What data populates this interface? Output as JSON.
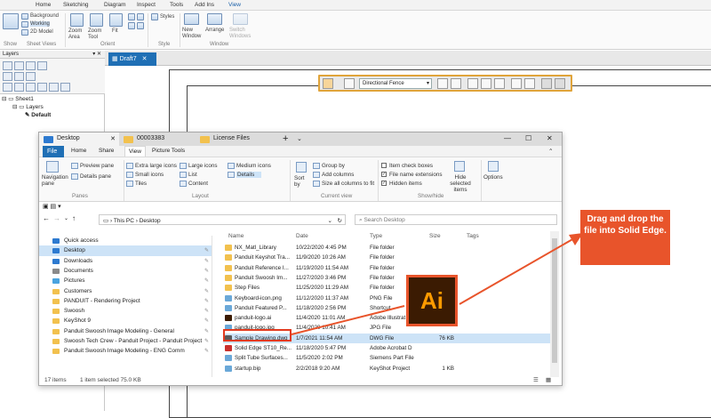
{
  "solid_edge": {
    "tabs": [
      "Home",
      "Sketching",
      "Diagram",
      "Inspect",
      "Tools",
      "Add Ins",
      "View"
    ],
    "active_tab": "View",
    "ribbon": {
      "sheet_views_items": [
        "Background",
        "Working",
        "2D Model"
      ],
      "zoom_area": "Zoom Area",
      "zoom_tool": "Zoom Tool",
      "fit": "Fit",
      "styles": "Styles",
      "new_window": "New Window",
      "arrange": "Arrange",
      "switch_windows": "Switch Windows",
      "groups": [
        "Show",
        "Sheet Views",
        "Orient",
        "Style",
        "Window"
      ]
    },
    "layers_pane": {
      "title": "Layers",
      "tree": [
        "Sheet1",
        "Layers",
        "Default"
      ]
    },
    "document_tab": "Draft7",
    "command_bar": {
      "fence_value": "Directional Fence"
    }
  },
  "explorer": {
    "tabs": [
      "Desktop",
      "00003383",
      "License Files"
    ],
    "menu": [
      "File",
      "Home",
      "Share",
      "View",
      "Picture Tools"
    ],
    "ribbon": {
      "navigation_pane": "Navigation pane",
      "preview_pane": "Preview pane",
      "details_pane": "Details pane",
      "panes_label": "Panes",
      "layout_items": [
        "Extra large icons",
        "Large icons",
        "Medium icons",
        "Small icons",
        "List",
        "Details",
        "Tiles",
        "Content"
      ],
      "layout_label": "Layout",
      "sort_by": "Sort by",
      "group_by": "Group by",
      "add_columns": "Add columns",
      "size_all_columns": "Size all columns to fit",
      "current_view_label": "Current view",
      "item_check_boxes": "Item check boxes",
      "file_name_extensions": "File name extensions",
      "hidden_items": "Hidden items",
      "hide_selected_items": "Hide selected items",
      "options": "Options",
      "show_hide_label": "Show/hide"
    },
    "address": {
      "path": [
        "This PC",
        "Desktop"
      ],
      "search_placeholder": "Search Desktop"
    },
    "nav_items": [
      {
        "label": "Quick access",
        "type": "star"
      },
      {
        "label": "Desktop",
        "type": "blue",
        "selected": true
      },
      {
        "label": "Downloads",
        "type": "down"
      },
      {
        "label": "Documents",
        "type": "doc"
      },
      {
        "label": "Pictures",
        "type": "pic"
      },
      {
        "label": "Customers",
        "type": "folder"
      },
      {
        "label": "PANDUIT - Rendering Project",
        "type": "folder"
      },
      {
        "label": "Swoosh",
        "type": "folder"
      },
      {
        "label": "KeyShot 9",
        "type": "folder"
      },
      {
        "label": "Panduit Swoosh Image Modeling - General",
        "type": "folder"
      },
      {
        "label": "Swoosh Tech Crew - Panduit Project - Panduit Project",
        "type": "folder"
      },
      {
        "label": "Panduit Swoosh Image Modeling - ENG Comm",
        "type": "folder"
      }
    ],
    "columns": [
      "Name",
      "Date",
      "Type",
      "Size",
      "Tags"
    ],
    "files": [
      {
        "name": "NX_Matl_Library",
        "date": "10/22/2020 4:45 PM",
        "type": "File folder",
        "size": "",
        "kind": "folder"
      },
      {
        "name": "Panduit Keyshot Tra...",
        "date": "11/9/2020 10:26 AM",
        "type": "File folder",
        "size": "",
        "kind": "folder"
      },
      {
        "name": "Panduit Reference I...",
        "date": "11/19/2020 11:54 AM",
        "type": "File folder",
        "size": "",
        "kind": "folder"
      },
      {
        "name": "Panduit Swoosh Im...",
        "date": "11/27/2020 3:46 PM",
        "type": "File folder",
        "size": "",
        "kind": "folder"
      },
      {
        "name": "Step Files",
        "date": "11/25/2020 11:29 AM",
        "type": "File folder",
        "size": "",
        "kind": "folder"
      },
      {
        "name": "Keyboard-icon.png",
        "date": "11/12/2020 11:37 AM",
        "type": "PNG File",
        "size": "",
        "kind": "img"
      },
      {
        "name": "Panduit Featured P...",
        "date": "11/18/2020 2:56 PM",
        "type": "Shortcut",
        "size": "",
        "kind": "img"
      },
      {
        "name": "panduit-logo.ai",
        "date": "11/4/2020 11:01 AM",
        "type": "Adobe Illustrat",
        "size": "",
        "kind": "ai"
      },
      {
        "name": "panduit-logo.jpg",
        "date": "11/4/2020 10:41 AM",
        "type": "JPG File",
        "size": "",
        "kind": "img"
      },
      {
        "name": "Sample Drawing.dwg",
        "date": "1/7/2021 11:54 AM",
        "type": "DWG File",
        "size": "76 KB",
        "kind": "dwg",
        "selected": true
      },
      {
        "name": "Solid Edge ST10_Re...",
        "date": "11/18/2020 5:47 PM",
        "type": "Adobe Acrobat D",
        "size": "",
        "kind": "pdf"
      },
      {
        "name": "Split Tube Surfaces...",
        "date": "11/5/2020 2:02 PM",
        "type": "Siemens Part File",
        "size": "",
        "kind": "img"
      },
      {
        "name": "startup.bip",
        "date": "2/2/2018 9:20 AM",
        "type": "KeyShot Project",
        "size": "1 KB",
        "kind": "img"
      }
    ],
    "status": {
      "items": "17 items",
      "selected": "1 item selected  75.0 KB"
    }
  },
  "callout_text": "Drag and drop the file into Solid Edge.",
  "drag_icon_text": "Ai",
  "colors": {
    "accent": "#e8542b",
    "explorer_blue": "#1f6fb5",
    "selection": "#cde3f7",
    "folder": "#f2c14e"
  }
}
